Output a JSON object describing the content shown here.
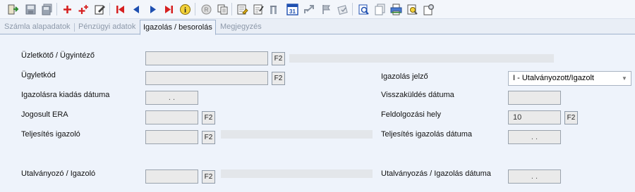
{
  "toolbar": {
    "icons": [
      "exit-icon",
      "save-icon",
      "save-all-icon",
      "add-icon",
      "add-multiple-icon",
      "edit-icon",
      "first-record-icon",
      "previous-record-icon",
      "next-record-icon",
      "last-record-icon",
      "info-icon",
      "cancel-icon",
      "copy-icon",
      "note-icon",
      "checklist-icon",
      "post-icon",
      "calendar-icon",
      "share-icon",
      "flag-icon",
      "stamp-icon",
      "preview-icon",
      "pages-icon",
      "print-icon",
      "print-preview-icon",
      "settings-icon"
    ],
    "calendar_label": "31",
    "info_label": "i",
    "colors": {
      "red": "#d62020",
      "blue": "#1e4fb0",
      "green": "#2f8a2f"
    }
  },
  "tabs": [
    {
      "label": "Számla alapadatok",
      "active": false
    },
    {
      "label": "Pénzügyi adatok",
      "active": false
    },
    {
      "label": "Igazolás / besorolás",
      "active": true
    },
    {
      "label": "Megjegyzés",
      "active": false
    }
  ],
  "form": {
    "f2_label": "F2",
    "uzletkoto_label": "Üzletkötő / Ügyintéző",
    "ugyletkod_label": "Ügyletkód",
    "igazolasra_kiadas_label": "Igazolásra kiadás dátuma",
    "igazolasra_kiadas_value": ". .",
    "jogosult_era_label": "Jogosult ERA",
    "teljesites_igazolo_label": "Teljesítés igazoló",
    "utalvanyozo_label": "Utalványozó / Igazoló",
    "igazolas_jelzo_label": "Igazolás jelző",
    "igazolas_jelzo_value": "I - Utalványozott/Igazolt",
    "visszakuldes_label": "Visszaküldés dátuma",
    "visszakuldes_value": "",
    "feldolgozasi_hely_label": "Feldolgozási hely",
    "feldolgozasi_hely_value": "10",
    "teljesites_igazolas_datum_label": "Teljesítés igazolás dátuma",
    "teljesites_igazolas_datum_value": ". .",
    "utalvanyozas_datum_label": "Utalványozás / Igazolás dátuma",
    "utalvanyozas_datum_value": ". ."
  }
}
